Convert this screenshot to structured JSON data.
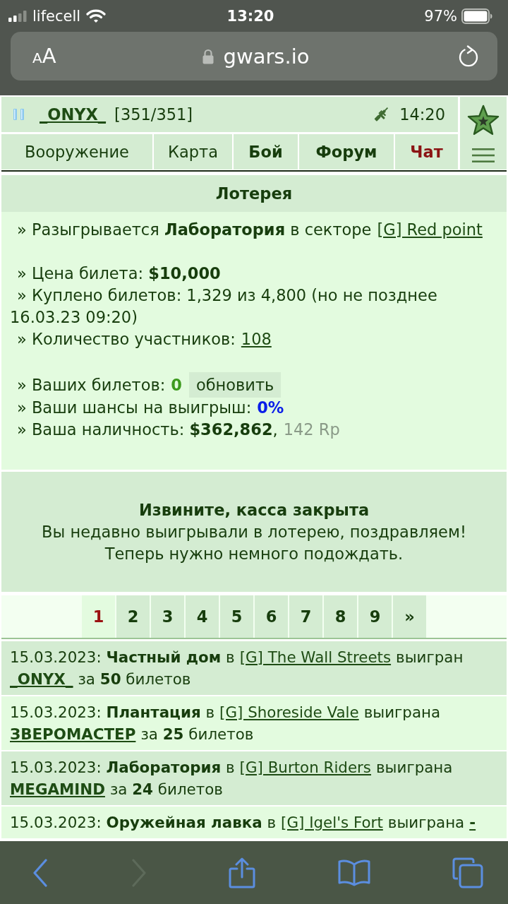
{
  "status_bar": {
    "carrier": "lifecell",
    "time": "13:20",
    "battery": "97%"
  },
  "address_bar": {
    "text_size_button": "AA",
    "url": "gwars.io"
  },
  "header": {
    "player_name": "_ONYX_",
    "hp": "[351/351]",
    "server_time": "14:20",
    "nav": [
      {
        "label": "Вооружение",
        "kind": "normal"
      },
      {
        "label": "Карта",
        "kind": "normal"
      },
      {
        "label": "Бой",
        "kind": "bold"
      },
      {
        "label": "Форум",
        "kind": "bold"
      },
      {
        "label": "Чат",
        "kind": "alert"
      }
    ]
  },
  "lottery": {
    "title": "Лотерея",
    "prize": {
      "text": "» Разыгрывается **Лаборатория** в секторе",
      "sector_link": "[G] Red point"
    },
    "price": "» Цена билета: **$10,000**",
    "bought": "» Куплено билетов: 1,329 из 4,800 (но не позднее 16.03.23 09:20)",
    "participants": {
      "label": "» Количество участников:",
      "link": "108"
    },
    "my_tickets": {
      "label": "» Ваших билетов:",
      "value": "0",
      "refresh_button": "обновить"
    },
    "chances": {
      "label": "» Ваши шансы на выигрыш:",
      "value": "0%"
    },
    "cash": {
      "label": "» Ваша наличность: **$362,862**,",
      "rp": "142 Rp"
    }
  },
  "notice": {
    "title": "Извините, касса закрыта",
    "lines": [
      "Вы недавно выигрывали в лотерею, поздравляем!",
      "Теперь нужно немного подождать."
    ]
  },
  "pagination": [
    {
      "label": "1",
      "selected": true
    },
    {
      "label": "2",
      "selected": false
    },
    {
      "label": "3",
      "selected": false
    },
    {
      "label": "4",
      "selected": false
    },
    {
      "label": "5",
      "selected": false
    },
    {
      "label": "6",
      "selected": false
    },
    {
      "label": "7",
      "selected": false
    },
    {
      "label": "8",
      "selected": false
    },
    {
      "label": "9",
      "selected": false
    },
    {
      "label": "»",
      "selected": false
    }
  ],
  "history": [
    {
      "text_before": "15.03.2023: **Частный дом** в",
      "sector": "[G] The Wall Streets",
      "verb": "выигран",
      "winner": "_ONYX_",
      "text_after": "за **50** билетов"
    },
    {
      "text_before": "15.03.2023: **Плантация** в",
      "sector": "[G] Shoreside Vale",
      "verb": "выиграна",
      "winner": "ЗВЕРОМАСТЕР",
      "text_after": "за **25** билетов"
    },
    {
      "text_before": "15.03.2023: **Лаборатория** в",
      "sector": "[G] Burton Riders",
      "verb": "выиграна",
      "winner": "MEGAMIND",
      "text_after": "за **24** билетов"
    },
    {
      "text_before": "15.03.2023: **Оружейная лавка** в",
      "sector": "[G] Igel's Fort",
      "verb": "выиграна",
      "winner": "-"
    }
  ],
  "browser_toolbar": {
    "back": {
      "disabled": false
    },
    "forward": {
      "disabled": true
    }
  }
}
